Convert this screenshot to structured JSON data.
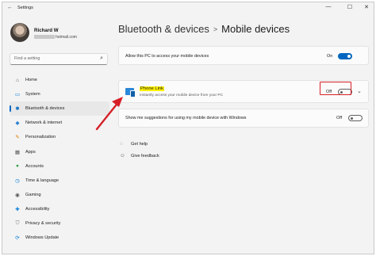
{
  "window": {
    "title": "Settings",
    "controls": {
      "minimize": "—",
      "maximize": "☐",
      "close": "✕"
    }
  },
  "user": {
    "name": "Richard W",
    "email_suffix": "hotmail.com"
  },
  "search": {
    "placeholder": "Find a setting",
    "icon": "search-icon"
  },
  "sidebar": {
    "items": [
      {
        "label": "Home",
        "icon": "home-icon",
        "glyph": "⌂",
        "color": "#555555"
      },
      {
        "label": "System",
        "icon": "monitor-icon",
        "glyph": "▭",
        "color": "#0078d4"
      },
      {
        "label": "Bluetooth & devices",
        "icon": "bluetooth-icon",
        "glyph": "✱",
        "color": "#0067c0",
        "active": true
      },
      {
        "label": "Network & internet",
        "icon": "wifi-icon",
        "glyph": "◆",
        "color": "#2a7fd4"
      },
      {
        "label": "Personalization",
        "icon": "brush-icon",
        "glyph": "✎",
        "color": "#e07b00"
      },
      {
        "label": "Apps",
        "icon": "apps-icon",
        "glyph": "▦",
        "color": "#555555"
      },
      {
        "label": "Accounts",
        "icon": "person-icon",
        "glyph": "●",
        "color": "#2ea043"
      },
      {
        "label": "Time & language",
        "icon": "clock-icon",
        "glyph": "◷",
        "color": "#0078d4"
      },
      {
        "label": "Gaming",
        "icon": "gamepad-icon",
        "glyph": "◉",
        "color": "#555555"
      },
      {
        "label": "Accessibility",
        "icon": "accessibility-icon",
        "glyph": "✚",
        "color": "#0078d4"
      },
      {
        "label": "Privacy & security",
        "icon": "shield-icon",
        "glyph": "⛉",
        "color": "#6b6b6b"
      },
      {
        "label": "Windows Update",
        "icon": "update-icon",
        "glyph": "⟳",
        "color": "#0078d4"
      }
    ]
  },
  "breadcrumb": {
    "parent": "Bluetooth & devices",
    "separator": ">",
    "current": "Mobile devices"
  },
  "cards": {
    "allow_access": {
      "text": "Allow this PC to access your mobile devices",
      "state": "On"
    },
    "phone_link": {
      "title": "Phone Link",
      "subtitle": "Instantly access your mobile device from your PC",
      "state": "Off"
    },
    "suggestions": {
      "text": "Show me suggestions for using my mobile device with Windows",
      "state": "Off"
    }
  },
  "links": {
    "get_help": "Get help",
    "give_feedback": "Give feedback"
  },
  "colors": {
    "accent": "#0067c0",
    "annotation": "#d61f26",
    "highlight": "#fff200"
  }
}
